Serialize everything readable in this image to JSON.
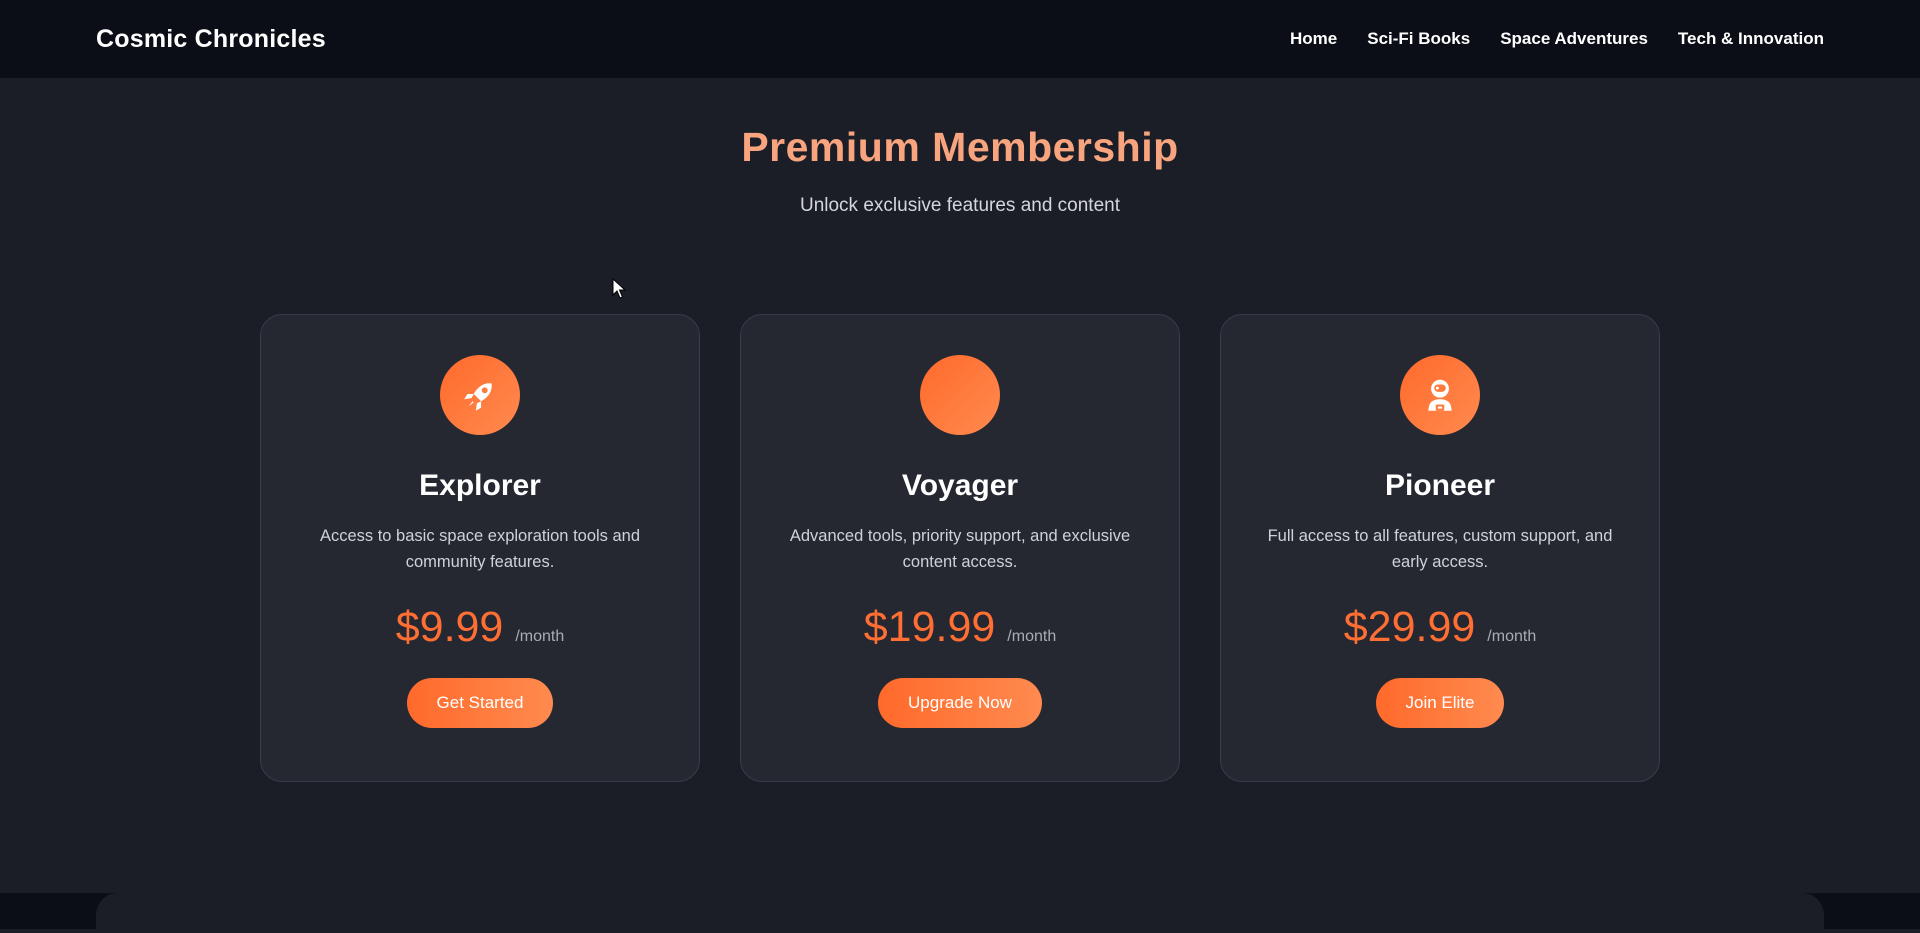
{
  "header": {
    "brand": "Cosmic Chronicles",
    "nav": [
      "Home",
      "Sci-Fi Books",
      "Space Adventures",
      "Tech & Innovation"
    ]
  },
  "hero": {
    "title": "Premium Membership",
    "subtitle": "Unlock exclusive features and content"
  },
  "plans": [
    {
      "icon": "rocket-icon",
      "title": "Explorer",
      "description": "Access to basic space exploration tools and community features.",
      "price": "$9.99",
      "period": "/month",
      "cta": "Get Started"
    },
    {
      "icon": "blank-circle-icon",
      "title": "Voyager",
      "description": "Advanced tools, priority support, and exclusive content access.",
      "price": "$19.99",
      "period": "/month",
      "cta": "Upgrade Now"
    },
    {
      "icon": "astronaut-icon",
      "title": "Pioneer",
      "description": "Full access to all features, custom support, and early access.",
      "price": "$29.99",
      "period": "/month",
      "cta": "Join Elite"
    }
  ],
  "colors": {
    "accent": "#ff6f34",
    "title_accent": "#f7a47f",
    "background": "#1b1e26",
    "card": "#252731",
    "navbar": "#0b0e16"
  }
}
